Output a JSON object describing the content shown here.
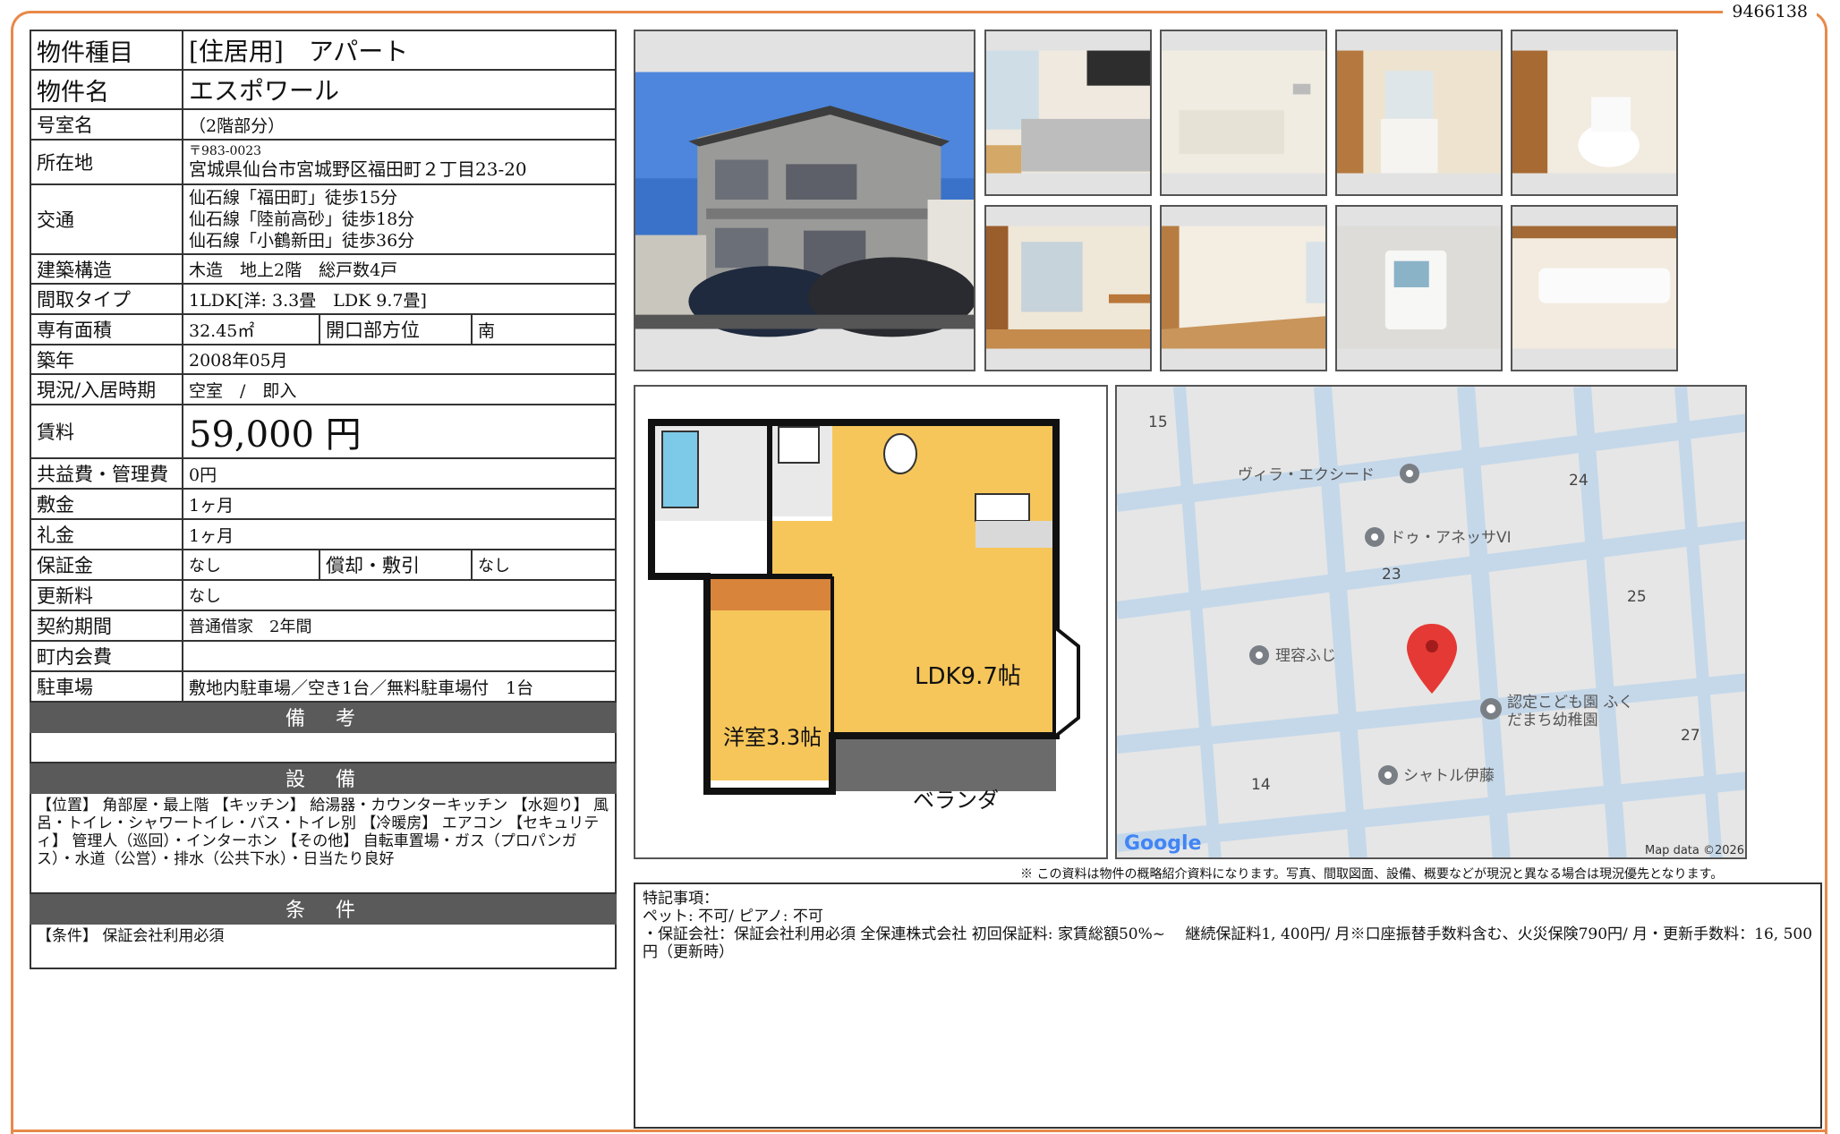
{
  "doc_id": "9466138",
  "spec": {
    "type": {
      "label": "物件種目",
      "value": "[住居用]　アパート"
    },
    "name": {
      "label": "物件名",
      "value": "エスポワール"
    },
    "room": {
      "label": "号室名",
      "value": "（2階部分）"
    },
    "address": {
      "label": "所在地",
      "zip": "〒983-0023",
      "value": "宮城県仙台市宮城野区福田町２丁目23-20"
    },
    "access": {
      "label": "交通",
      "lines": [
        "仙石線「福田町」徒歩15分",
        "仙石線「陸前高砂」徒歩18分",
        "仙石線「小鶴新田」徒歩36分"
      ]
    },
    "structure": {
      "label": "建築構造",
      "value": "木造　地上2階　総戸数4戸"
    },
    "layout": {
      "label": "間取タイプ",
      "value": "1LDK[洋: 3.3畳　LDK 9.7畳]"
    },
    "area": {
      "label": "専有面積",
      "value": "32.45㎡",
      "label2": "開口部方位",
      "value2": "南"
    },
    "built": {
      "label": "築年",
      "value": "2008年05月"
    },
    "status": {
      "label": "現況/入居時期",
      "value": "空室　/　即入"
    },
    "rent": {
      "label": "賃料",
      "value": "59,000 円"
    },
    "common_fee": {
      "label": "共益費・管理費",
      "value": "0円"
    },
    "deposit": {
      "label": "敷金",
      "value": "1ヶ月"
    },
    "key_money": {
      "label": "礼金",
      "value": "1ヶ月"
    },
    "guarantee": {
      "label": "保証金",
      "value": "なし",
      "label2": "償却・敷引",
      "value2": "なし"
    },
    "renewal": {
      "label": "更新料",
      "value": "なし"
    },
    "contract": {
      "label": "契約期間",
      "value": "普通借家　2年間"
    },
    "town_fee": {
      "label": "町内会費",
      "value": ""
    },
    "parking": {
      "label": "駐車場",
      "value": "敷地内駐車場／空き1台／無料駐車場付　1台"
    },
    "remarks_head": "備　考",
    "remarks": "",
    "equipment_head": "設　備",
    "equipment": "【位置】 角部屋・最上階 【キッチン】 給湯器・カウンターキッチン 【水廻り】 風呂・トイレ・シャワートイレ・バス・トイレ別 【冷暖房】 エアコン 【セキュリティ】 管理人（巡回）・インターホン 【その他】 自転車置場・ガス（プロパンガス）・水道（公営）・排水（公共下水）・日当たり良好",
    "conditions_head": "条　件",
    "conditions": "【条件】 保証会社利用必須"
  },
  "floorplan": {
    "ldk": "LDK9.7帖",
    "western": "洋室3.3帖",
    "veranda": "ベランダ"
  },
  "map": {
    "places": [
      "ヴィラ・エクシード",
      "ドゥ・アネッサVI",
      "理容ふじ",
      "認定こども園 ふく",
      "だまち幼稚園",
      "シャトル伊藤"
    ],
    "blocks": [
      "15",
      "24",
      "23",
      "25",
      "27",
      "14"
    ],
    "logo": "Google",
    "attribution": "Map data ©2026"
  },
  "disclaimer": "※ この資料は物件の概略紹介資料になります。写真、間取図面、設備、概要などが現況と異なる場合は現況優先となります。",
  "notes": {
    "title": "特記事項：",
    "lines": [
      "ペット: 不可/ ピアノ: 不可",
      "・保証会社：保証会社利用必須 全保連株式会社 初回保証料: 家賃総額50%~　 継続保証料1, 400円/ 月※口座振替手数料含む、火災保険790円/ 月・更新手数料：16, 500円（更新時）"
    ]
  }
}
